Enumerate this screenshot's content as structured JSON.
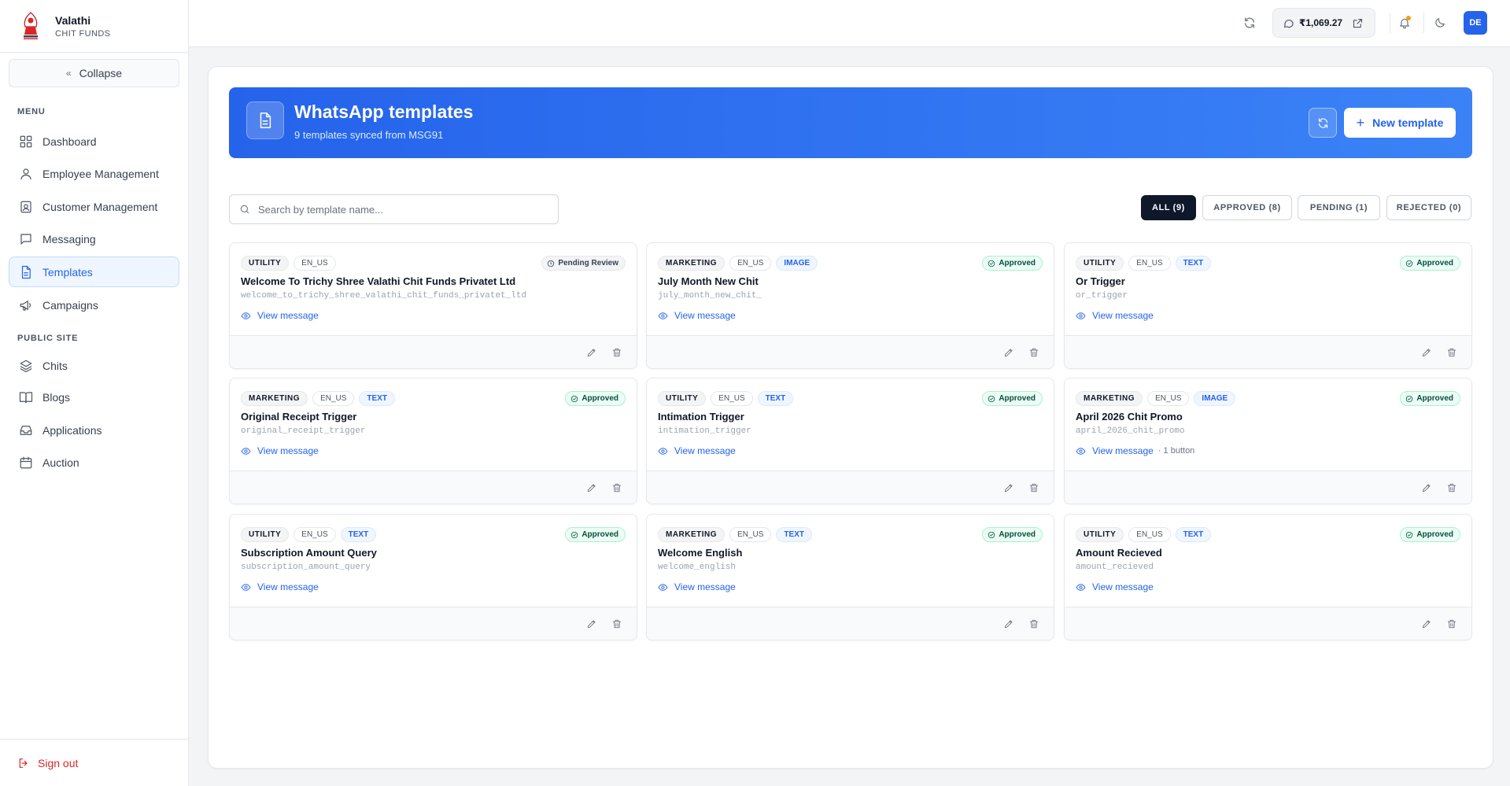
{
  "brand": {
    "name": "Valathi",
    "subtitle": "CHIT FUNDS"
  },
  "sidebar": {
    "collapse_label": "Collapse",
    "menu_label": "MENU",
    "public_label": "PUBLIC SITE",
    "menu_items": [
      {
        "label": "Dashboard",
        "icon": "grid-icon"
      },
      {
        "label": "Employee Management",
        "icon": "user-icon"
      },
      {
        "label": "Customer Management",
        "icon": "id-card-icon"
      },
      {
        "label": "Messaging",
        "icon": "chat-icon"
      },
      {
        "label": "Templates",
        "icon": "document-icon",
        "active": true
      },
      {
        "label": "Campaigns",
        "icon": "megaphone-icon"
      }
    ],
    "public_items": [
      {
        "label": "Chits",
        "icon": "layers-icon"
      },
      {
        "label": "Blogs",
        "icon": "book-icon"
      },
      {
        "label": "Applications",
        "icon": "inbox-icon"
      },
      {
        "label": "Auction",
        "icon": "calendar-icon"
      }
    ],
    "signout_label": "Sign out"
  },
  "topbar": {
    "balance": "₹1,069.27",
    "avatar_initials": "DE",
    "notification_dot_color": "#f59e0b"
  },
  "hero": {
    "title": "WhatsApp templates",
    "subtitle": "9 templates synced from MSG91",
    "new_button": "New template"
  },
  "search": {
    "placeholder": "Search by template name...",
    "value": ""
  },
  "filters": [
    {
      "label": "ALL (9)",
      "active": true
    },
    {
      "label": "APPROVED (8)",
      "active": false
    },
    {
      "label": "PENDING (1)",
      "active": false
    },
    {
      "label": "REJECTED (0)",
      "active": false
    }
  ],
  "templates": [
    {
      "category": "UTILITY",
      "language": "EN_US",
      "type": "",
      "status": "Pending Review",
      "name": "Welcome To Trichy Shree Valathi Chit Funds Privatet Ltd",
      "slug": "welcome_to_trichy_shree_valathi_chit_funds_privatet_ltd",
      "view_label": "View message",
      "buttons": ""
    },
    {
      "category": "MARKETING",
      "language": "EN_US",
      "type": "IMAGE",
      "status": "Approved",
      "name": "July Month New Chit",
      "slug": "july_month_new_chit_",
      "view_label": "View message",
      "buttons": ""
    },
    {
      "category": "UTILITY",
      "language": "EN_US",
      "type": "TEXT",
      "status": "Approved",
      "name": "Or Trigger",
      "slug": "or_trigger",
      "view_label": "View message",
      "buttons": ""
    },
    {
      "category": "MARKETING",
      "language": "EN_US",
      "type": "TEXT",
      "status": "Approved",
      "name": "Original Receipt Trigger",
      "slug": "original_receipt_trigger",
      "view_label": "View message",
      "buttons": ""
    },
    {
      "category": "UTILITY",
      "language": "EN_US",
      "type": "TEXT",
      "status": "Approved",
      "name": "Intimation Trigger",
      "slug": "intimation_trigger",
      "view_label": "View message",
      "buttons": ""
    },
    {
      "category": "MARKETING",
      "language": "EN_US",
      "type": "IMAGE",
      "status": "Approved",
      "name": "April 2026 Chit Promo",
      "slug": "april_2026_chit_promo",
      "view_label": "View message",
      "buttons": "· 1 button"
    },
    {
      "category": "UTILITY",
      "language": "EN_US",
      "type": "TEXT",
      "status": "Approved",
      "name": "Subscription Amount Query",
      "slug": "subscription_amount_query",
      "view_label": "View message",
      "buttons": ""
    },
    {
      "category": "MARKETING",
      "language": "EN_US",
      "type": "TEXT",
      "status": "Approved",
      "name": "Welcome English",
      "slug": "welcome_english",
      "view_label": "View message",
      "buttons": ""
    },
    {
      "category": "UTILITY",
      "language": "EN_US",
      "type": "TEXT",
      "status": "Approved",
      "name": "Amount Recieved",
      "slug": "amount_recieved",
      "view_label": "View message",
      "buttons": ""
    }
  ],
  "colors": {
    "accent": "#2563eb",
    "approved_bg": "#ecfdf5",
    "danger": "#dc2626",
    "dark_chip": "#0f172a"
  }
}
